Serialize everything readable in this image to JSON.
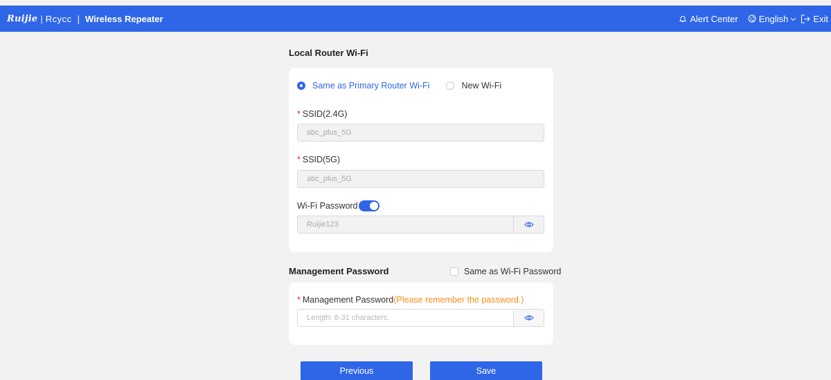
{
  "header": {
    "brand_ruijie": "Ruijie",
    "brand_sep": "|",
    "brand_reyee": "Rcycc",
    "title_sep": "|",
    "title": "Wireless Repeater",
    "alert_center": "Alert Center",
    "language": "English",
    "exit": "Exit",
    "color": "#2f66e8"
  },
  "local_wifi": {
    "title": "Local Router Wi-Fi",
    "options": [
      {
        "label": "Same as Primary Router Wi-Fi",
        "selected": true
      },
      {
        "label": "New Wi-Fi",
        "selected": false
      }
    ],
    "ssid24": {
      "required": "*",
      "label": "SSID(2.4G)",
      "value": "abc_plus_5G"
    },
    "ssid5": {
      "required": "*",
      "label": "SSID(5G)",
      "value": "abc_plus_5G"
    },
    "password": {
      "label": "Wi-Fi Password",
      "enabled": true,
      "value": "Ruijie123"
    }
  },
  "management": {
    "title": "Management Password",
    "same_as_wifi": {
      "label": "Same as Wi-Fi Password",
      "checked": false
    },
    "password": {
      "required": "*",
      "label": "Management Password",
      "hint": "(Please remember the password.)",
      "placeholder": "Length: 8-31 characters."
    }
  },
  "buttons": {
    "previous": "Previous",
    "save": "Save"
  }
}
